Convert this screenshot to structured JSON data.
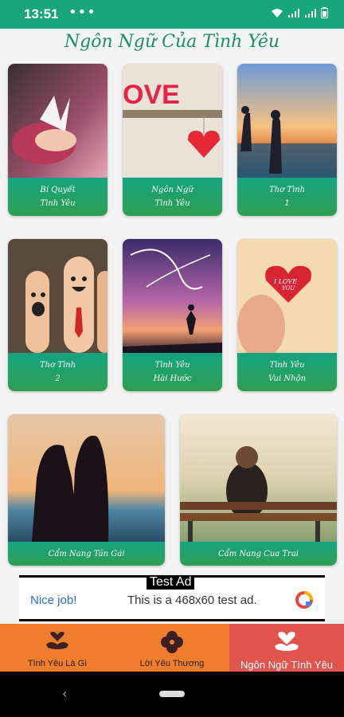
{
  "status": {
    "time": "13:51",
    "dots": "•••"
  },
  "header": {
    "title": "Ngôn Ngữ Của Tình Yêu"
  },
  "cards": [
    {
      "line1": "Bí Quyết",
      "line2": "Tình Yêu"
    },
    {
      "line1": "Ngôn Ngữ",
      "line2": "Tình Yêu"
    },
    {
      "line1": "Thơ Tình",
      "line2": "1"
    },
    {
      "line1": "Thơ Tình",
      "line2": "2"
    },
    {
      "line1": "Tình Yêu",
      "line2": "Hài Hước"
    },
    {
      "line1": "Tình Yêu",
      "line2": "Vui Nhộn"
    },
    {
      "line1": "Cẩm Nang Tán Gái",
      "line2": ""
    },
    {
      "line1": "Cẩm Nang Cua Trai",
      "line2": ""
    }
  ],
  "ad": {
    "title": "Test Ad",
    "nice": "Nice job!",
    "text": "This is a 468x60 test ad."
  },
  "nav": [
    {
      "label": "Tình Yêu Là Gì",
      "icon": "hands-heart-icon"
    },
    {
      "label": "Lời Yêu Thương",
      "icon": "flower-icon"
    },
    {
      "label": "Ngôn Ngữ Tình Yêu",
      "icon": "heart-hands-icon"
    }
  ],
  "colors": {
    "accent": "#17a77a",
    "nav_bg": "#f07d2c",
    "nav_active": "#e0554e"
  }
}
